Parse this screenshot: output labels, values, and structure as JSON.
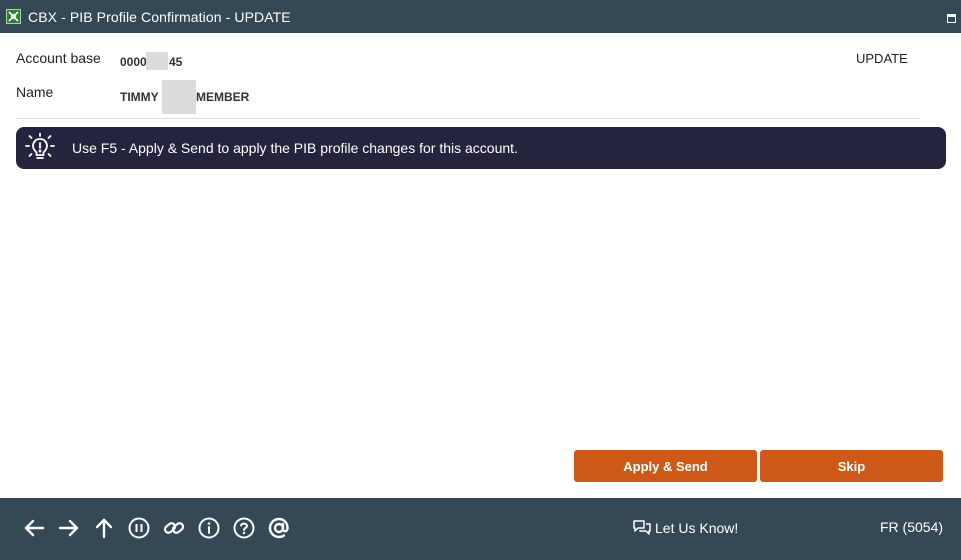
{
  "window": {
    "title": "CBX - PIB Profile Confirmation - UPDATE",
    "app_icon": "app-logo-icon",
    "maximize_icon": "maximize-icon"
  },
  "header": {
    "account_base_label": "Account base",
    "account_base_value_prefix": "0000",
    "account_base_value_suffix": "45",
    "name_label": "Name",
    "name_value_prefix": "TIMMY",
    "name_value_suffix": "MEMBER",
    "mode": "UPDATE"
  },
  "banner": {
    "icon": "lightbulb-icon",
    "message": "Use F5 - Apply & Send to apply the PIB profile changes for this account."
  },
  "actions": {
    "apply_send_label": "Apply & Send",
    "skip_label": "Skip",
    "button_color": "#cd5a18"
  },
  "footer": {
    "nav_icons": [
      "back-arrow-icon",
      "forward-arrow-icon",
      "up-arrow-icon",
      "pause-icon",
      "link-icon",
      "info-icon",
      "help-icon",
      "at-icon"
    ],
    "feedback_label": "Let Us Know!",
    "feedback_icon": "chat-icon",
    "env_label": "FR (5054)"
  },
  "colors": {
    "titlebar": "#344955",
    "banner": "#25243f",
    "footer": "#344955"
  }
}
